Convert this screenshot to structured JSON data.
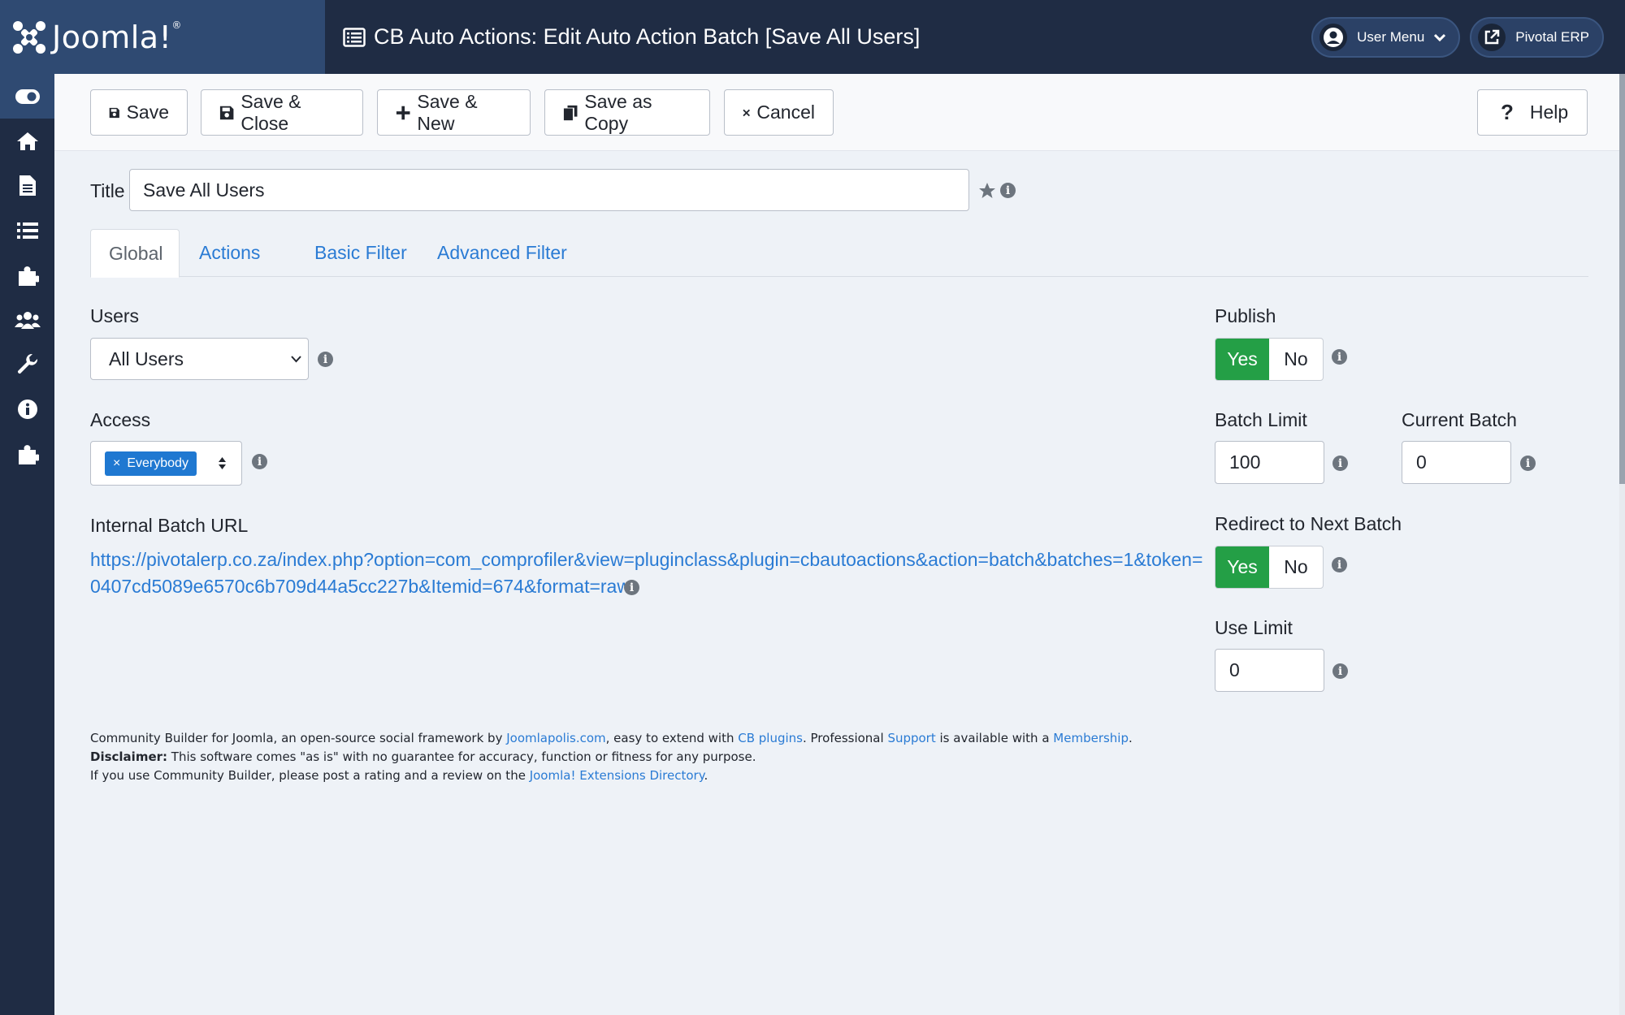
{
  "header": {
    "logo_text": "Joomla!",
    "page_title": "CB Auto Actions: Edit Auto Action Batch [Save All Users]",
    "user_menu_label": "User Menu",
    "site_link_label": "Pivotal ERP"
  },
  "sidebar": {
    "items": [
      "toggle-menu",
      "home",
      "content",
      "menus",
      "components",
      "users",
      "system",
      "help",
      "extensions"
    ]
  },
  "toolbar": {
    "save_label": "Save",
    "save_close_label": "Save & Close",
    "save_new_label": "Save & New",
    "save_copy_label": "Save as Copy",
    "cancel_label": "Cancel",
    "help_label": "Help"
  },
  "form": {
    "title_label": "Title",
    "title_value": "Save All Users",
    "tabs": [
      "Global",
      "Actions",
      "Basic Filter",
      "Advanced Filter"
    ],
    "active_tab": "Global",
    "users_label": "Users",
    "users_value": "All Users",
    "access_label": "Access",
    "access_chip": "Everybody",
    "access_chip_remove": "×",
    "internal_batch_url_label": "Internal Batch URL",
    "internal_batch_url_line1": "https://pivotalerp.co.za/index.php?option=com_comprofiler&view=pluginclass&plugin=cbautoactions&action=batch&batches=1&token=",
    "internal_batch_url_line2": "0407cd5089e6570c6b709d44a5cc227b&Itemid=674&format=raw",
    "publish_label": "Publish",
    "publish_yes": "Yes",
    "publish_no": "No",
    "publish_value": "Yes",
    "batch_limit_label": "Batch Limit",
    "batch_limit_value": "100",
    "current_batch_label": "Current Batch",
    "current_batch_value": "0",
    "redirect_label": "Redirect to Next Batch",
    "redirect_yes": "Yes",
    "redirect_no": "No",
    "redirect_value": "Yes",
    "use_limit_label": "Use Limit",
    "use_limit_value": "0"
  },
  "footer": {
    "line1_a": "Community Builder for Joomla, an open-source social framework by ",
    "link_joomlapolis": "Joomlapolis.com",
    "line1_b": ", easy to extend with ",
    "link_cb_plugins": "CB plugins",
    "line1_c": ". Professional ",
    "link_support": "Support",
    "line1_d": " is available with a ",
    "link_membership": "Membership",
    "line1_e": ".",
    "disclaimer_label": "Disclaimer:",
    "disclaimer_text": " This software comes \"as is\" with no guarantee for accuracy, function or fitness for any purpose.",
    "line3_a": "If you use Community Builder, please post a rating and a review on the ",
    "link_jed": "Joomla! Extensions Directory",
    "line3_b": "."
  },
  "colors": {
    "header_bg": "#1f2c44",
    "logo_bg": "#2f4a72",
    "page_bg": "#eef2f7",
    "link": "#2a7bd4",
    "toggle_on": "#249f46",
    "chip": "#1f78d1"
  }
}
